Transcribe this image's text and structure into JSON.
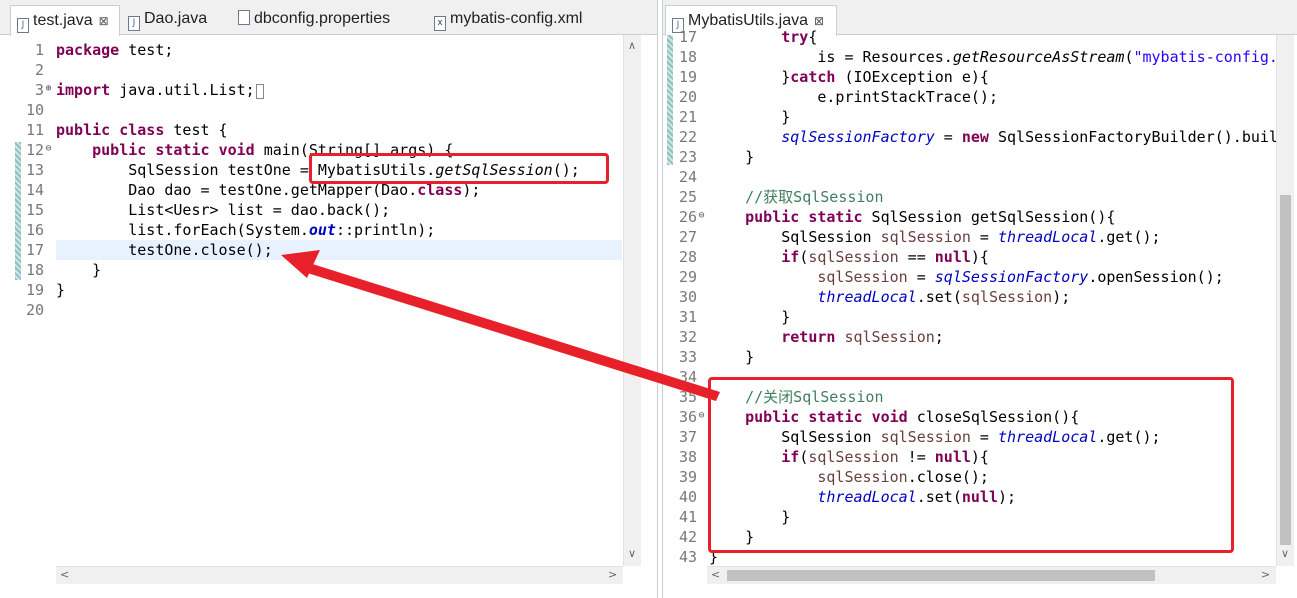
{
  "left_editor": {
    "tabs": [
      {
        "label": "test.java",
        "icon": "java-file-icon",
        "active": true,
        "close": "⊠"
      },
      {
        "label": "Dao.java",
        "icon": "java-file-icon",
        "active": false
      },
      {
        "label": "dbconfig.properties",
        "icon": "properties-file-icon",
        "active": false
      },
      {
        "label": "mybatis-config.xml",
        "icon": "xml-file-icon",
        "active": false
      }
    ],
    "line_numbers": [
      "1",
      "2",
      "3",
      "10",
      "11",
      "12",
      "13",
      "14",
      "15",
      "16",
      "17",
      "18",
      "19",
      "20"
    ],
    "code": {
      "l1_kw": "package",
      "l1_rest": " test;",
      "l3_kw": "import",
      "l3_rest": " java.util.List;",
      "l11_kw1": "public",
      "l11_kw2": "class",
      "l11_rest": " test {",
      "l12_indent": "    ",
      "l12_kw1": "public",
      "l12_kw2": "static",
      "l12_kw3": "void",
      "l12_rest": " main(String[] args) {",
      "l13_a": "        SqlSession testOne = ",
      "l13_b": "MybatisUtils.",
      "l13_c": "getSqlSession",
      "l13_d": "();",
      "l14_a": "        Dao dao = testOne.getMapper(Dao.",
      "l14_kw": "class",
      "l14_b": ");",
      "l15": "        List<Uesr> list = dao.back();",
      "l16_a": "        list.forEach(System.",
      "l16_f": "out",
      "l16_b": "::println);",
      "l17": "        testOne.close();",
      "l18": "    }",
      "l19": "}"
    }
  },
  "right_editor": {
    "tabs": [
      {
        "label": "MybatisUtils.java",
        "icon": "java-file-icon",
        "active": true,
        "close": "⊠"
      }
    ],
    "line_numbers": [
      "17",
      "18",
      "19",
      "20",
      "21",
      "22",
      "23",
      "24",
      "25",
      "26",
      "27",
      "28",
      "29",
      "30",
      "31",
      "32",
      "33",
      "34",
      "35",
      "36",
      "37",
      "38",
      "39",
      "40",
      "41",
      "42",
      "43"
    ],
    "code": {
      "l17": "        try{",
      "l18_a": "            is = Resources.",
      "l18_b": "getResourceAsStream",
      "l18_c": "(",
      "l18_s": "\"mybatis-config.",
      "l19_a": "        }",
      "l19_kw": "catch",
      "l19_b": " (IOException e){",
      "l20": "            e.printStackTrace();",
      "l21": "        }",
      "l22_f": "sqlSessionFactory",
      "l22_a": " = ",
      "l22_kw": "new",
      "l22_b": " SqlSessionFactoryBuilder().buil",
      "l23": "    }",
      "l25": "    //获取SqlSession",
      "l26_kw1": "public",
      "l26_kw2": "static",
      "l26_b": " SqlSession getSqlSession(){",
      "l27_a": "        SqlSession ",
      "l27_v": "sqlSession",
      "l27_b": " = ",
      "l27_f": "threadLocal",
      "l27_c": ".get();",
      "l28_kw": "if",
      "l28_a": "(",
      "l28_v": "sqlSession",
      "l28_b": " == ",
      "l28_kw2": "null",
      "l28_c": "){",
      "l29_v": "sqlSession",
      "l29_a": " = ",
      "l29_f": "sqlSessionFactory",
      "l29_b": ".openSession();",
      "l30_f": "threadLocal",
      "l30_a": ".set(",
      "l30_v": "sqlSession",
      "l30_b": ");",
      "l31": "        }",
      "l32_kw": "return",
      "l32_v": " sqlSession",
      "l32_b": ";",
      "l33": "    }",
      "l35": "    //关闭SqlSession",
      "l36_kw1": "public",
      "l36_kw2": "static",
      "l36_kw3": "void",
      "l36_b": " closeSqlSession(){",
      "l37_a": "        SqlSession ",
      "l37_v": "sqlSession",
      "l37_b": " = ",
      "l37_f": "threadLocal",
      "l37_c": ".get();",
      "l38_kw": "if",
      "l38_a": "(",
      "l38_v": "sqlSession",
      "l38_b": " != ",
      "l38_kw2": "null",
      "l38_c": "){",
      "l39_v": "sqlSession",
      "l39_b": ".close();",
      "l40_f": "threadLocal",
      "l40_a": ".set(",
      "l40_kw": "null",
      "l40_b": ");",
      "l41": "        }",
      "l42": "    }",
      "l43": "}"
    }
  },
  "annotations": {
    "highlight_color": "#e8202a",
    "arrow_color": "#e8202a"
  }
}
